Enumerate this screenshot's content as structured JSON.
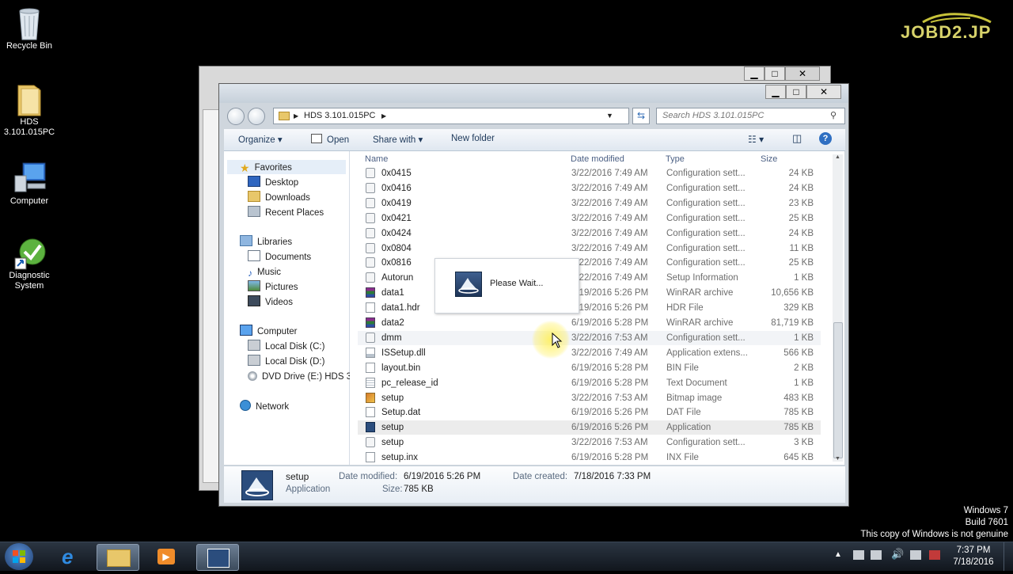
{
  "watermark": "JOBD2.JP",
  "desktop_icons": [
    {
      "label": "Recycle Bin",
      "icon": "recycle-bin-icon"
    },
    {
      "label": "HDS 3.101.015PC",
      "icon": "folder-icon"
    },
    {
      "label": "Computer",
      "icon": "computer-icon"
    },
    {
      "label": "Diagnostic System",
      "icon": "diagnostic-system-icon"
    }
  ],
  "explorer": {
    "address_path": "HDS 3.101.015PC",
    "search_placeholder": "Search HDS 3.101.015PC",
    "toolbar": {
      "organize": "Organize",
      "open": "Open",
      "share_with": "Share with",
      "new_folder": "New folder"
    },
    "nav": {
      "favorites": "Favorites",
      "favorites_items": [
        "Desktop",
        "Downloads",
        "Recent Places"
      ],
      "libraries": "Libraries",
      "libraries_items": [
        "Documents",
        "Music",
        "Pictures",
        "Videos"
      ],
      "computer": "Computer",
      "computer_items": [
        "Local Disk (C:)",
        "Local Disk (D:)",
        "DVD Drive (E:) HDS 3"
      ],
      "network": "Network"
    },
    "columns": {
      "name": "Name",
      "date": "Date modified",
      "type": "Type",
      "size": "Size"
    },
    "files": [
      {
        "name": "0x0415",
        "date": "3/22/2016 7:49 AM",
        "type": "Configuration sett...",
        "size": "24 KB",
        "icon": "config-file-icon"
      },
      {
        "name": "0x0416",
        "date": "3/22/2016 7:49 AM",
        "type": "Configuration sett...",
        "size": "24 KB",
        "icon": "config-file-icon"
      },
      {
        "name": "0x0419",
        "date": "3/22/2016 7:49 AM",
        "type": "Configuration sett...",
        "size": "23 KB",
        "icon": "config-file-icon"
      },
      {
        "name": "0x0421",
        "date": "3/22/2016 7:49 AM",
        "type": "Configuration sett...",
        "size": "25 KB",
        "icon": "config-file-icon"
      },
      {
        "name": "0x0424",
        "date": "3/22/2016 7:49 AM",
        "type": "Configuration sett...",
        "size": "24 KB",
        "icon": "config-file-icon"
      },
      {
        "name": "0x0804",
        "date": "3/22/2016 7:49 AM",
        "type": "Configuration sett...",
        "size": "11 KB",
        "icon": "config-file-icon"
      },
      {
        "name": "0x0816",
        "date": "3/22/2016 7:49 AM",
        "type": "Configuration sett...",
        "size": "25 KB",
        "icon": "config-file-icon"
      },
      {
        "name": "Autorun",
        "date": "3/22/2016 7:49 AM",
        "type": "Setup Information",
        "size": "1 KB",
        "icon": "config-file-icon"
      },
      {
        "name": "data1",
        "date": "6/19/2016 5:26 PM",
        "type": "WinRAR archive",
        "size": "10,656 KB",
        "icon": "winrar-icon"
      },
      {
        "name": "data1.hdr",
        "date": "6/19/2016 5:26 PM",
        "type": "HDR File",
        "size": "329 KB",
        "icon": "blank-file-icon"
      },
      {
        "name": "data2",
        "date": "6/19/2016 5:28 PM",
        "type": "WinRAR archive",
        "size": "81,719 KB",
        "icon": "winrar-icon"
      },
      {
        "name": "dmm",
        "date": "3/22/2016 7:53 AM",
        "type": "Configuration sett...",
        "size": "1 KB",
        "icon": "config-file-icon"
      },
      {
        "name": "ISSetup.dll",
        "date": "3/22/2016 7:49 AM",
        "type": "Application extens...",
        "size": "566 KB",
        "icon": "dll-file-icon"
      },
      {
        "name": "layout.bin",
        "date": "6/19/2016 5:28 PM",
        "type": "BIN File",
        "size": "2 KB",
        "icon": "blank-file-icon"
      },
      {
        "name": "pc_release_id",
        "date": "6/19/2016 5:28 PM",
        "type": "Text Document",
        "size": "1 KB",
        "icon": "text-file-icon"
      },
      {
        "name": "setup",
        "date": "3/22/2016 7:53 AM",
        "type": "Bitmap image",
        "size": "483 KB",
        "icon": "bitmap-icon"
      },
      {
        "name": "Setup.dat",
        "date": "6/19/2016 5:26 PM",
        "type": "DAT File",
        "size": "785 KB",
        "icon": "blank-file-icon"
      },
      {
        "name": "setup",
        "date": "6/19/2016 5:26 PM",
        "type": "Application",
        "size": "785 KB",
        "icon": "setup-app-icon"
      },
      {
        "name": "setup",
        "date": "3/22/2016 7:53 AM",
        "type": "Configuration sett...",
        "size": "3 KB",
        "icon": "config-file-icon"
      },
      {
        "name": "setup.inx",
        "date": "6/19/2016 5:28 PM",
        "type": "INX File",
        "size": "645 KB",
        "icon": "blank-file-icon"
      }
    ],
    "details": {
      "name": "setup",
      "type": "Application",
      "date_modified_label": "Date modified:",
      "date_modified": "6/19/2016 5:26 PM",
      "date_created_label": "Date created:",
      "date_created": "7/18/2016 7:33 PM",
      "size_label": "Size:",
      "size": "785 KB"
    }
  },
  "dialog": {
    "text": "Please Wait..."
  },
  "windows_notice": {
    "line1": "Windows 7",
    "line2": "Build 7601",
    "line3": "This copy of Windows is not genuine"
  },
  "taskbar": {
    "time": "7:37 PM",
    "date": "7/18/2016"
  }
}
